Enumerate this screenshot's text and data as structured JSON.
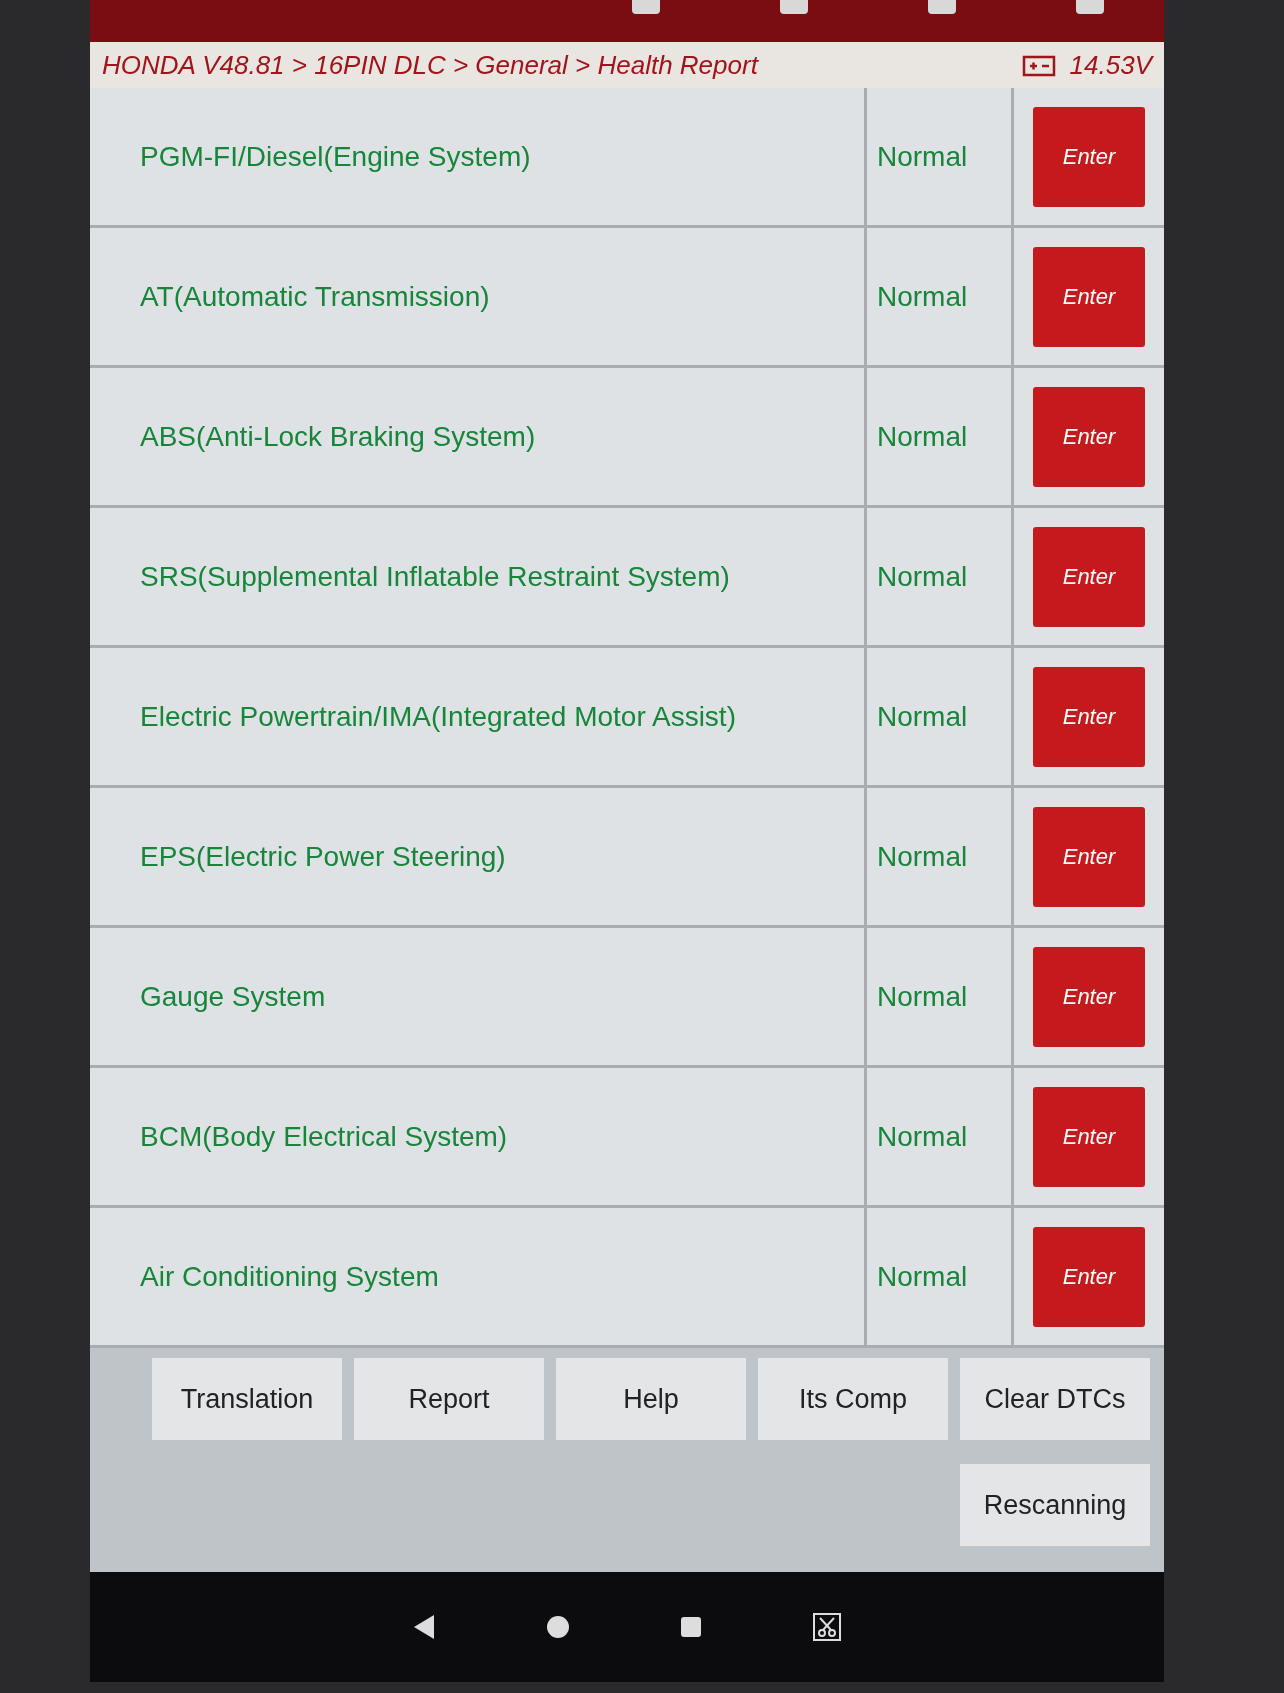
{
  "breadcrumb": "HONDA V48.81 > 16PIN DLC > General > Health Report",
  "voltage": "14.53V",
  "systems": [
    {
      "name": "PGM-FI/Diesel(Engine System)",
      "status": "Normal",
      "action": "Enter"
    },
    {
      "name": "AT(Automatic Transmission)",
      "status": "Normal",
      "action": "Enter"
    },
    {
      "name": "ABS(Anti-Lock Braking System)",
      "status": "Normal",
      "action": "Enter"
    },
    {
      "name": "SRS(Supplemental Inflatable Restraint System)",
      "status": "Normal",
      "action": "Enter"
    },
    {
      "name": "Electric Powertrain/IMA(Integrated Motor Assist)",
      "status": "Normal",
      "action": "Enter"
    },
    {
      "name": "EPS(Electric Power Steering)",
      "status": "Normal",
      "action": "Enter"
    },
    {
      "name": "Gauge System",
      "status": "Normal",
      "action": "Enter"
    },
    {
      "name": "BCM(Body Electrical System)",
      "status": "Normal",
      "action": "Enter"
    },
    {
      "name": "Air Conditioning System",
      "status": "Normal",
      "action": "Enter"
    }
  ],
  "buttons": [
    [
      "Translation",
      "Report",
      "Help",
      "Its Comp",
      "Clear DTCs"
    ],
    [
      "Rescanning"
    ]
  ]
}
